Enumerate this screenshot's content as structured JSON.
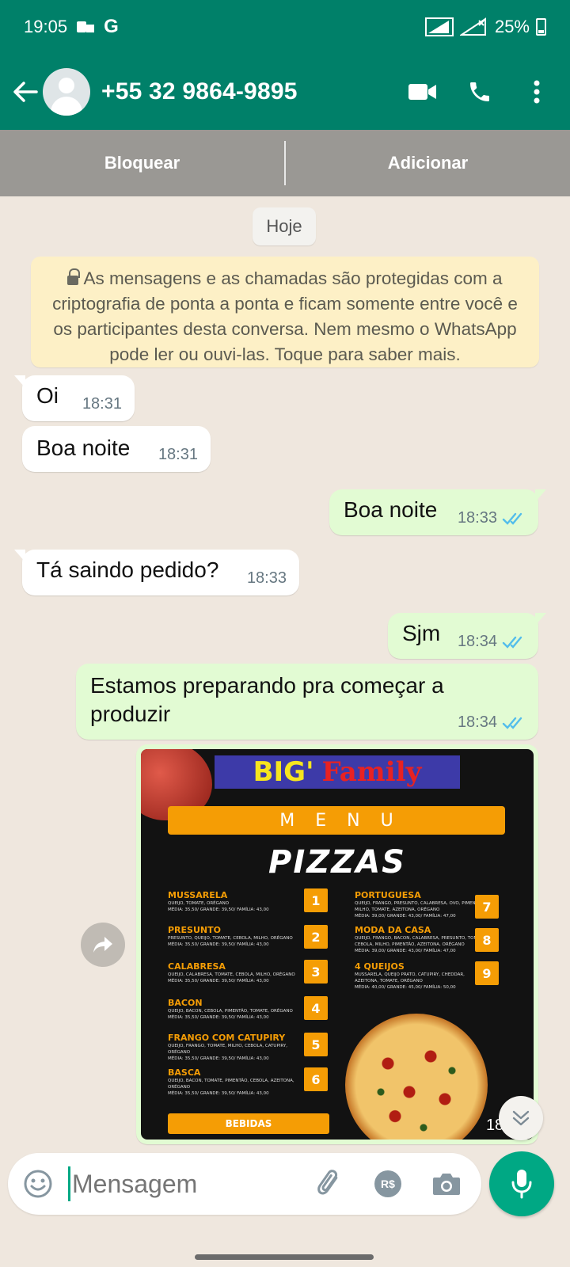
{
  "status_bar": {
    "time": "19:05",
    "carrier_icon": "G",
    "battery": "25%"
  },
  "contact": {
    "name": "+55 32 9864-9895"
  },
  "block_bar": {
    "block": "Bloquear",
    "add": "Adicionar"
  },
  "chat": {
    "date_chip": "Hoje",
    "encryption_notice": "As mensagens e as chamadas são protegidas com a criptografia de ponta a ponta e ficam somente entre você e os participantes desta conversa. Nem mesmo o WhatsApp pode ler ou ouvi-las. Toque para saber mais.",
    "messages": [
      {
        "dir": "in",
        "text": "Oi",
        "time": "18:31"
      },
      {
        "dir": "in",
        "text": "Boa noite",
        "time": "18:31"
      },
      {
        "dir": "out",
        "text": "Boa noite",
        "time": "18:33",
        "status": "read"
      },
      {
        "dir": "in",
        "text": "Tá saindo pedido?",
        "time": "18:33"
      },
      {
        "dir": "out",
        "text": "Sjm",
        "time": "18:34",
        "status": "read"
      },
      {
        "dir": "out",
        "text_line1": "Estamos preparando pra começar a",
        "text_line2": "produzir",
        "time": "18:34",
        "status": "read"
      }
    ],
    "image_message": {
      "time": "18:35",
      "menu": {
        "brand_big": "BIG'",
        "brand_family": "Family",
        "menu_label": "MENU",
        "heading": "PIZZAS",
        "drinks": "BEBIDAS",
        "items": [
          {
            "num": "1",
            "name": "MUSSARELA",
            "desc": "QUEIJO, TOMATE, ORÉGANO",
            "prices": "MÉDIA: 35,50/ GRANDE: 39,50/ FAMÍLIA: 43,00"
          },
          {
            "num": "2",
            "name": "PRESUNTO",
            "desc": "PRESUNTO, QUEIJO, TOMATE, CEBOLA, MILHO, ORÉGANO",
            "prices": "MÉDIA: 35,50/ GRANDE: 39,50/ FAMÍLIA: 43,00"
          },
          {
            "num": "3",
            "name": "CALABRESA",
            "desc": "QUEIJO, CALABRESA, TOMATE, CEBOLA, MILHO, ORÉGANO",
            "prices": "MÉDIA: 35,50/ GRANDE: 39,50/ FAMÍLIA: 43,00"
          },
          {
            "num": "4",
            "name": "BACON",
            "desc": "QUEIJO, BACON, CEBOLA, PIMENTÃO, TOMATE, ORÉGANO",
            "prices": "MÉDIA: 35,50/ GRANDE: 39,50/ FAMÍLIA: 43,00"
          },
          {
            "num": "5",
            "name": "FRANGO COM CATUPIRY",
            "desc": "QUEIJO, FRANGO, TOMATE, MILHO, CEBOLA, CATUPIRY, ORÉGANO",
            "prices": "MÉDIA: 35,50/ GRANDE: 39,50/ FAMÍLIA: 43,00"
          },
          {
            "num": "6",
            "name": "BASCA",
            "desc": "QUEIJO, BACON, TOMATE, PIMENTÃO, CEBOLA, AZEITONA, ORÉGANO",
            "prices": "MÉDIA: 35,50/ GRANDE: 39,50/ FAMÍLIA: 43,00"
          },
          {
            "num": "7",
            "name": "PORTUGUESA",
            "desc": "QUEIJO, FRANGO, PRESUNTO, CALABRESA, OVO, PIMENTÃO, MILHO, TOMATE, AZEITONA, ORÉGANO",
            "prices": "MÉDIA: 39,00/ GRANDE: 43,00/ FAMÍLIA: 47,00"
          },
          {
            "num": "8",
            "name": "MODA DA CASA",
            "desc": "QUEIJO, FRANGO, BACON, CALABRESA, PRESUNTO, TOMATE, CEBOLA, MILHO, PIMENTÃO, AZEITONA, ORÉGANO",
            "prices": "MÉDIA: 39,00/ GRANDE: 43,00/ FAMÍLIA: 47,00"
          },
          {
            "num": "9",
            "name": "4 QUEIJOS",
            "desc": "MUSSARELA, QUEIJO PRATO, CATUPIRY, CHEDDAR, AZEITONA, TOMATE, ORÉGANO",
            "prices": "MÉDIA: 40,00/ GRANDE: 45,00/ FAMÍLIA: 50,00"
          }
        ]
      }
    }
  },
  "composer": {
    "placeholder": "Mensagem",
    "payment_label": "R$"
  },
  "colors": {
    "header": "#008069",
    "accent": "#00a884",
    "outgoing_bubble": "#e2fbd3",
    "read_ticks": "#53bdeb"
  }
}
